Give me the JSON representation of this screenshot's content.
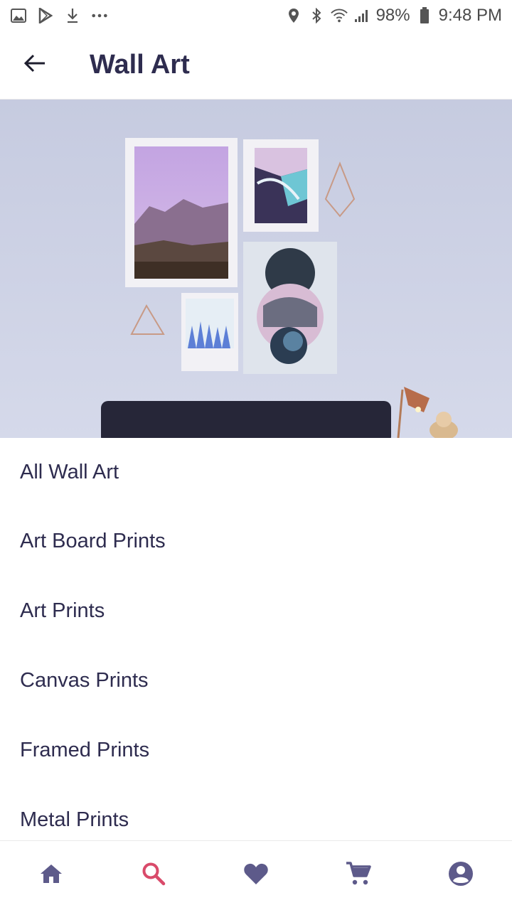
{
  "status_bar": {
    "battery": "98%",
    "time": "9:48 PM",
    "left_icons": [
      "image-icon",
      "play-store-icon",
      "download-icon",
      "more-dots-icon"
    ],
    "right_icons": [
      "location-icon",
      "bluetooth-icon",
      "wifi-icon",
      "signal-icon",
      "battery-icon"
    ]
  },
  "app_bar": {
    "title": "Wall Art",
    "back_icon": "arrow-left-icon"
  },
  "categories": [
    "All Wall Art",
    "Art Board Prints",
    "Art Prints",
    "Canvas Prints",
    "Framed Prints",
    "Metal Prints"
  ],
  "bottom_nav": {
    "items": [
      "home-icon",
      "search-icon",
      "heart-icon",
      "cart-icon",
      "account-icon"
    ],
    "active": "search-icon",
    "colors": {
      "default": "#5d5a8a",
      "active": "#d94a6a"
    }
  }
}
